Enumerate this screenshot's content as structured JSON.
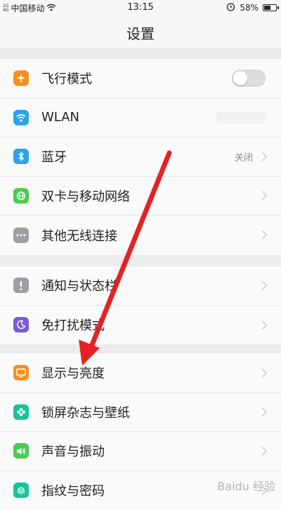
{
  "status": {
    "network_label": "2G\n4G",
    "carrier": "中国移动",
    "time": "13:15",
    "battery": "58%",
    "battery_level": 0.58
  },
  "header": {
    "title": "设置"
  },
  "groups": [
    {
      "items": [
        {
          "label": "飞行模式",
          "icon": "airplane-icon",
          "color": "#f5901f",
          "control": "toggle",
          "toggle_on": false
        },
        {
          "label": "WLAN",
          "icon": "wifi-icon",
          "color": "#2aa4e9",
          "control": "blurred"
        },
        {
          "label": "蓝牙",
          "icon": "bluetooth-icon",
          "color": "#2aa4e9",
          "value": "关闭",
          "control": "chevron"
        },
        {
          "label": "双卡与移动网络",
          "icon": "globe-icon",
          "color": "#4ccb53",
          "control": "chevron"
        },
        {
          "label": "其他无线连接",
          "icon": "more-dots-icon",
          "color": "#9aa0a6",
          "control": "chevron"
        }
      ]
    },
    {
      "items": [
        {
          "label": "通知与状态栏",
          "icon": "exclamation-icon",
          "color": "#9aa0a6",
          "control": "chevron"
        },
        {
          "label": "免打扰模式",
          "icon": "moon-icon",
          "color": "#7a5be0",
          "control": "chevron"
        }
      ]
    },
    {
      "items": [
        {
          "label": "显示与亮度",
          "icon": "display-icon",
          "color": "#f5901f",
          "control": "chevron"
        },
        {
          "label": "锁屏杂志与壁纸",
          "icon": "flower-icon",
          "color": "#18c29c",
          "control": "chevron"
        },
        {
          "label": "声音与振动",
          "icon": "speaker-icon",
          "color": "#4ccb53",
          "control": "chevron"
        },
        {
          "label": "指纹与密码",
          "icon": "fingerprint-icon",
          "color": "#18c29c",
          "control": "chevron"
        }
      ]
    }
  ],
  "watermark": "Baidu 经验",
  "annotation": {
    "color": "#e52222"
  }
}
